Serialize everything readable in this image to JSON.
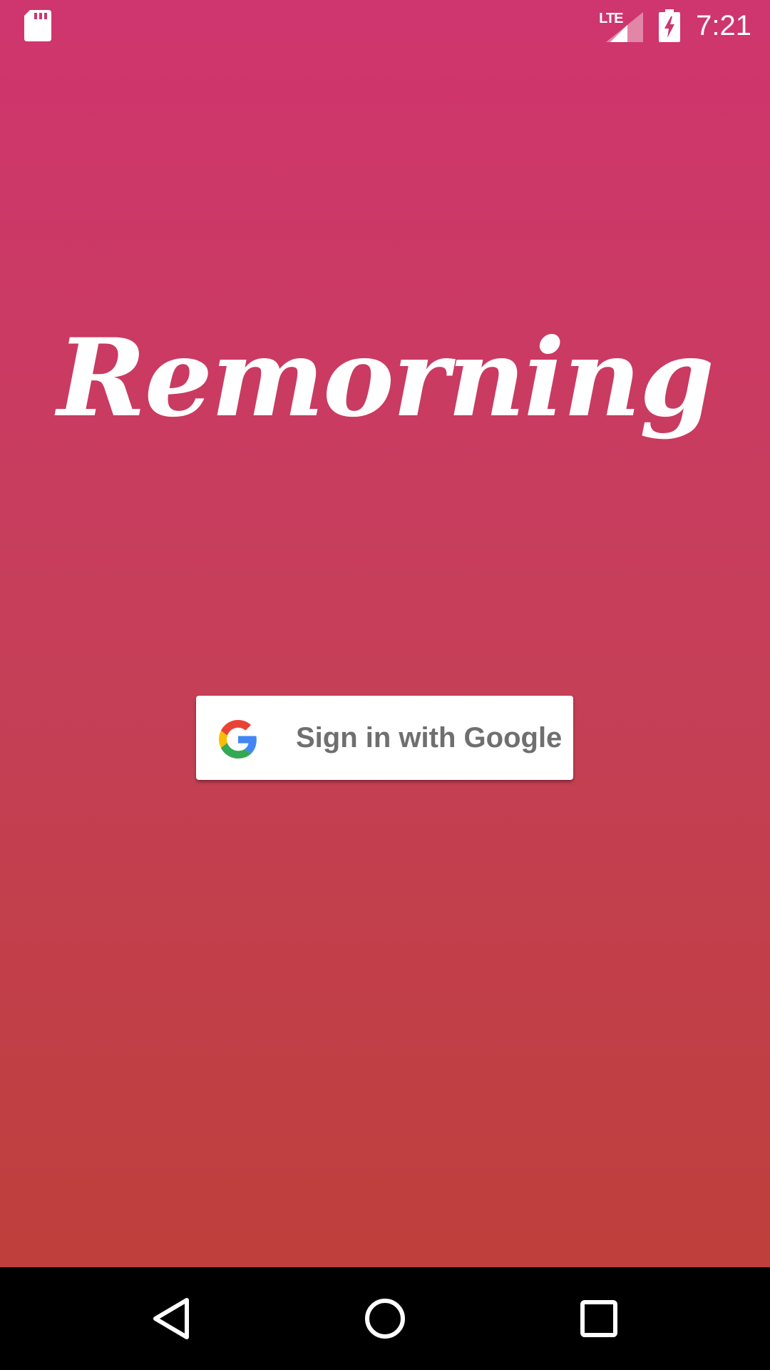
{
  "status_bar": {
    "time": "7:21",
    "network_label": "LTE",
    "icons": [
      "sd-card-icon",
      "lte-signal-icon",
      "battery-charging-icon"
    ]
  },
  "app": {
    "logo_text": "Remorning"
  },
  "signin": {
    "label": "Sign in with Google",
    "icon": "google-g-icon"
  },
  "nav_bar": {
    "icons": [
      "back-icon",
      "home-icon",
      "recents-icon"
    ]
  },
  "colors": {
    "gradient_top": "#cf356e",
    "gradient_bottom": "#bd3f36",
    "button_background": "#ffffff",
    "button_text": "#6f6f6f",
    "nav_background": "#000000"
  }
}
